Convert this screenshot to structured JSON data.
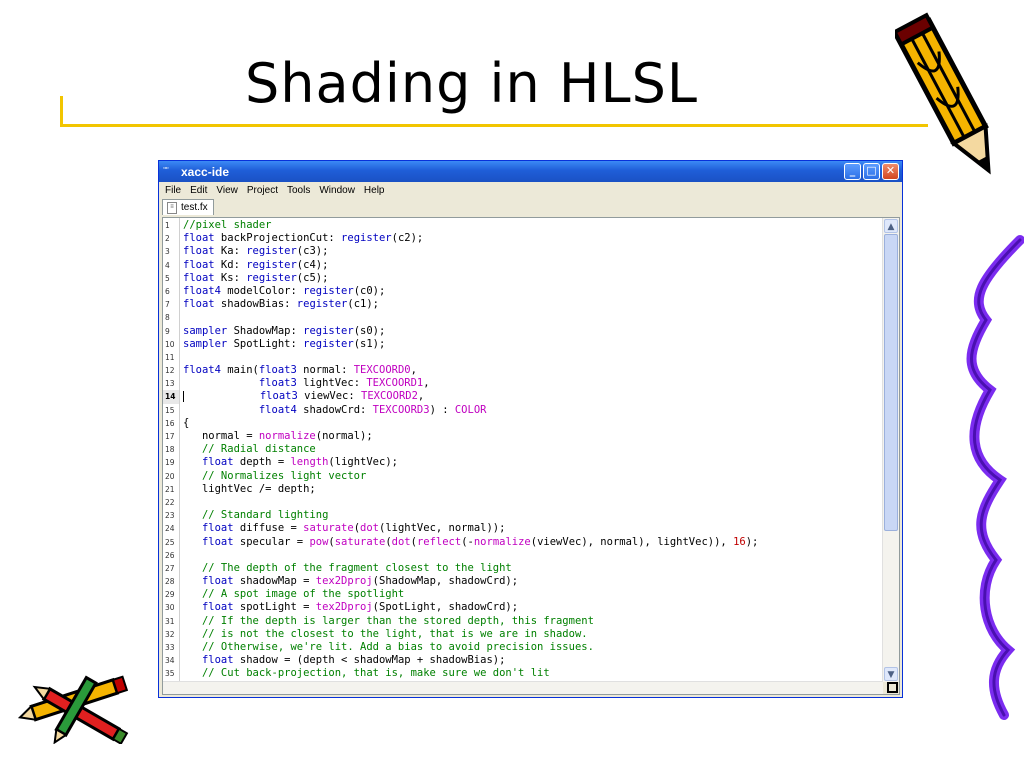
{
  "slide": {
    "title": "Shading in HLSL"
  },
  "window": {
    "title": "xacc-ide",
    "app_icon_text": "▫▫▫",
    "menu": [
      "File",
      "Edit",
      "View",
      "Project",
      "Tools",
      "Window",
      "Help"
    ],
    "tab_label": "test.fx",
    "controls": {
      "minimize": "_",
      "maximize": "□",
      "close": "✕"
    }
  },
  "editor": {
    "current_line": 14,
    "lines": [
      [
        [
          "cm",
          "//pixel shader"
        ]
      ],
      [
        [
          "kw",
          "float"
        ],
        [
          "t",
          " backProjectionCut: "
        ],
        [
          "kw",
          "register"
        ],
        [
          "t",
          "(c2);"
        ]
      ],
      [
        [
          "kw",
          "float"
        ],
        [
          "t",
          " Ka: "
        ],
        [
          "kw",
          "register"
        ],
        [
          "t",
          "(c3);"
        ]
      ],
      [
        [
          "kw",
          "float"
        ],
        [
          "t",
          " Kd: "
        ],
        [
          "kw",
          "register"
        ],
        [
          "t",
          "(c4);"
        ]
      ],
      [
        [
          "kw",
          "float"
        ],
        [
          "t",
          " Ks: "
        ],
        [
          "kw",
          "register"
        ],
        [
          "t",
          "(c5);"
        ]
      ],
      [
        [
          "kw",
          "float4"
        ],
        [
          "t",
          " modelColor: "
        ],
        [
          "kw",
          "register"
        ],
        [
          "t",
          "(c0);"
        ]
      ],
      [
        [
          "kw",
          "float"
        ],
        [
          "t",
          " shadowBias: "
        ],
        [
          "kw",
          "register"
        ],
        [
          "t",
          "(c1);"
        ]
      ],
      [],
      [
        [
          "kw",
          "sampler"
        ],
        [
          "t",
          " ShadowMap: "
        ],
        [
          "kw",
          "register"
        ],
        [
          "t",
          "(s0);"
        ]
      ],
      [
        [
          "kw",
          "sampler"
        ],
        [
          "t",
          " SpotLight: "
        ],
        [
          "kw",
          "register"
        ],
        [
          "t",
          "(s1);"
        ]
      ],
      [],
      [
        [
          "kw",
          "float4"
        ],
        [
          "t",
          " main("
        ],
        [
          "kw",
          "float3"
        ],
        [
          "t",
          " normal: "
        ],
        [
          "mg",
          "TEXCOORD0"
        ],
        [
          "t",
          ","
        ]
      ],
      [
        [
          "t",
          "            "
        ],
        [
          "kw",
          "float3"
        ],
        [
          "t",
          " lightVec: "
        ],
        [
          "mg",
          "TEXCOORD1"
        ],
        [
          "t",
          ","
        ]
      ],
      [
        [
          "caret",
          ""
        ],
        [
          "t",
          "            "
        ],
        [
          "kw",
          "float3"
        ],
        [
          "t",
          " viewVec: "
        ],
        [
          "mg",
          "TEXCOORD2"
        ],
        [
          "t",
          ","
        ]
      ],
      [
        [
          "t",
          "            "
        ],
        [
          "kw",
          "float4"
        ],
        [
          "t",
          " shadowCrd: "
        ],
        [
          "mg",
          "TEXCOORD3"
        ],
        [
          "t",
          ") : "
        ],
        [
          "mg",
          "COLOR"
        ]
      ],
      [
        [
          "t",
          "{"
        ]
      ],
      [
        [
          "t",
          "   normal = "
        ],
        [
          "mg",
          "normalize"
        ],
        [
          "t",
          "(normal);"
        ]
      ],
      [
        [
          "t",
          "   "
        ],
        [
          "cm",
          "// Radial distance"
        ]
      ],
      [
        [
          "t",
          "   "
        ],
        [
          "kw",
          "float"
        ],
        [
          "t",
          " depth = "
        ],
        [
          "mg",
          "length"
        ],
        [
          "t",
          "(lightVec);"
        ]
      ],
      [
        [
          "t",
          "   "
        ],
        [
          "cm",
          "// Normalizes light vector"
        ]
      ],
      [
        [
          "t",
          "   lightVec /= depth;"
        ]
      ],
      [],
      [
        [
          "t",
          "   "
        ],
        [
          "cm",
          "// Standard lighting"
        ]
      ],
      [
        [
          "t",
          "   "
        ],
        [
          "kw",
          "float"
        ],
        [
          "t",
          " diffuse = "
        ],
        [
          "mg",
          "saturate"
        ],
        [
          "t",
          "("
        ],
        [
          "mg",
          "dot"
        ],
        [
          "t",
          "(lightVec, normal));"
        ]
      ],
      [
        [
          "t",
          "   "
        ],
        [
          "kw",
          "float"
        ],
        [
          "t",
          " specular = "
        ],
        [
          "mg",
          "pow"
        ],
        [
          "t",
          "("
        ],
        [
          "mg",
          "saturate"
        ],
        [
          "t",
          "("
        ],
        [
          "mg",
          "dot"
        ],
        [
          "t",
          "("
        ],
        [
          "mg",
          "reflect"
        ],
        [
          "t",
          "(-"
        ],
        [
          "mg",
          "normalize"
        ],
        [
          "t",
          "(viewVec), normal), lightVec)), "
        ],
        [
          "num",
          "16"
        ],
        [
          "t",
          ");"
        ]
      ],
      [],
      [
        [
          "t",
          "   "
        ],
        [
          "cm",
          "// The depth of the fragment closest to the light"
        ]
      ],
      [
        [
          "t",
          "   "
        ],
        [
          "kw",
          "float"
        ],
        [
          "t",
          " shadowMap = "
        ],
        [
          "mg",
          "tex2Dproj"
        ],
        [
          "t",
          "(ShadowMap, shadowCrd);"
        ]
      ],
      [
        [
          "t",
          "   "
        ],
        [
          "cm",
          "// A spot image of the spotlight"
        ]
      ],
      [
        [
          "t",
          "   "
        ],
        [
          "kw",
          "float"
        ],
        [
          "t",
          " spotLight = "
        ],
        [
          "mg",
          "tex2Dproj"
        ],
        [
          "t",
          "(SpotLight, shadowCrd);"
        ]
      ],
      [
        [
          "t",
          "   "
        ],
        [
          "cm",
          "// If the depth is larger than the stored depth, this fragment"
        ]
      ],
      [
        [
          "t",
          "   "
        ],
        [
          "cm",
          "// is not the closest to the light, that is we are in shadow."
        ]
      ],
      [
        [
          "t",
          "   "
        ],
        [
          "cm",
          "// Otherwise, we're lit. Add a bias to avoid precision issues."
        ]
      ],
      [
        [
          "t",
          "   "
        ],
        [
          "kw",
          "float"
        ],
        [
          "t",
          " shadow = (depth < shadowMap + shadowBias);"
        ]
      ],
      [
        [
          "t",
          "   "
        ],
        [
          "cm",
          "// Cut back-projection, that is, make sure we don't lit"
        ]
      ]
    ]
  },
  "colors": {
    "keyword": "#0000c0",
    "comment": "#008000",
    "builtin": "#c000c0",
    "number": "#c00000",
    "accent": "#f2c500"
  },
  "icons": {
    "decor_top_right": "pencil-icon",
    "decor_bottom_left": "pencils-icon",
    "decor_right": "squiggle-icon"
  }
}
